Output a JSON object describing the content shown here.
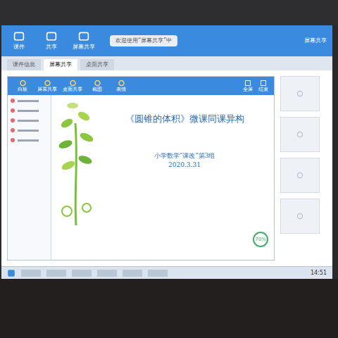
{
  "window": {
    "title": "屏幕共享"
  },
  "toolbar": [
    {
      "label": "课件"
    },
    {
      "label": "共享"
    },
    {
      "label": "屏幕共享"
    }
  ],
  "notice": "欢迎使用“屏幕共享”中",
  "tabs": [
    {
      "label": "课件信息",
      "selected": false
    },
    {
      "label": "屏幕共享",
      "selected": true
    },
    {
      "label": "桌面共享",
      "selected": false
    }
  ],
  "inner": {
    "toolbar": [
      {
        "label": "白板"
      },
      {
        "label": "屏幕共享"
      },
      {
        "label": "桌面共享"
      },
      {
        "label": "截图"
      },
      {
        "label": "表情"
      }
    ],
    "controls": [
      {
        "label": "全屏"
      },
      {
        "label": "结束"
      }
    ]
  },
  "slide": {
    "title": "《圆锥的体积》微课同课异构",
    "subtitle": "小学数学“课改”第3组",
    "date": "2020.3.31",
    "badge": "70%"
  },
  "taskbar": {
    "time": "14:51"
  }
}
